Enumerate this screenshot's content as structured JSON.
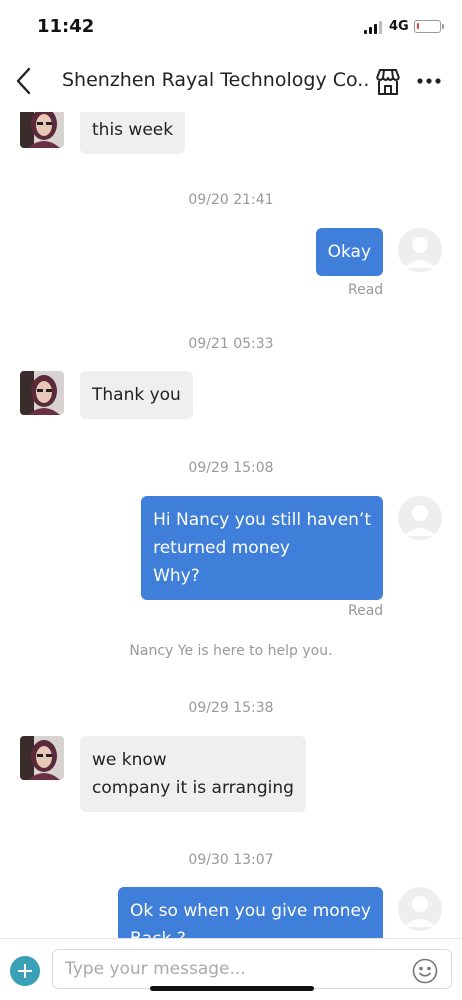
{
  "status_bar": {
    "time": "11:42",
    "network": "4G",
    "battery_level": 0.1,
    "battery_color": "#e53935"
  },
  "header": {
    "title": "Shenzhen Rayal Technology Co....",
    "back_icon": "chevron-left-icon",
    "store_icon": "store-icon",
    "more_icon": "more-horizontal-icon"
  },
  "messages": {
    "m1": {
      "text": "this week"
    },
    "ts1": "09/20 21:41",
    "m2": {
      "text": "Okay",
      "status": "Read"
    },
    "ts2": "09/21 05:33",
    "m3": {
      "text": "Thank you"
    },
    "ts3": "09/29 15:08",
    "m4": {
      "text": "Hi Nancy you still haven’t\nreturned money\nWhy?",
      "status": "Read"
    },
    "system": "Nancy Ye is here to help you.",
    "ts4": "09/29 15:38",
    "m5": {
      "text": "we know\ncompany it is arranging"
    },
    "ts5": "09/30 13:07",
    "m6": {
      "text": "Ok so when you give money\nBack ?"
    }
  },
  "input": {
    "placeholder": "Type your message..."
  },
  "colors": {
    "my_bubble": "#3f7fd9",
    "their_bubble": "#efefef",
    "plus_button": "#3aa0b5",
    "meta_text": "#999999"
  }
}
